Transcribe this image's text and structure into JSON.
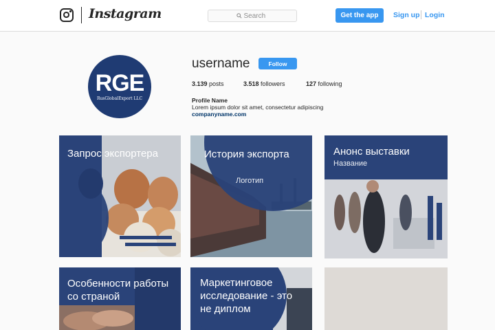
{
  "header": {
    "brand_name": "Instagram",
    "search_placeholder": "Search",
    "get_app_label": "Get the app",
    "signup_label": "Sign up",
    "login_label": "Login"
  },
  "profile": {
    "avatar_monogram": "RGE",
    "avatar_company": "RusGlobalExport LLC",
    "username": "username",
    "follow_label": "Follow",
    "posts_count": "3.139",
    "posts_label": "posts",
    "followers_count": "3.518",
    "followers_label": "followers",
    "following_count": "127",
    "following_label": "following",
    "bio_name": "Profile Name",
    "bio_text": "Lorem ipsum dolor sit amet, consectetur adipiscing",
    "bio_link": "companyname.com"
  },
  "grid": {
    "posts": [
      {
        "title": "Запрос экспортера"
      },
      {
        "title": "История экспорта",
        "subtitle": "Логотип"
      },
      {
        "title": "Анонс выставки",
        "subtitle": "Название"
      },
      {
        "title": "Особенности работы со страной"
      },
      {
        "title": "Маркетинговое исследование - это не диплом"
      },
      {
        "title": ""
      }
    ]
  },
  "colors": {
    "accent_blue": "#3897f0",
    "brand_navy": "#1f3b73",
    "link_blue": "#003569"
  }
}
